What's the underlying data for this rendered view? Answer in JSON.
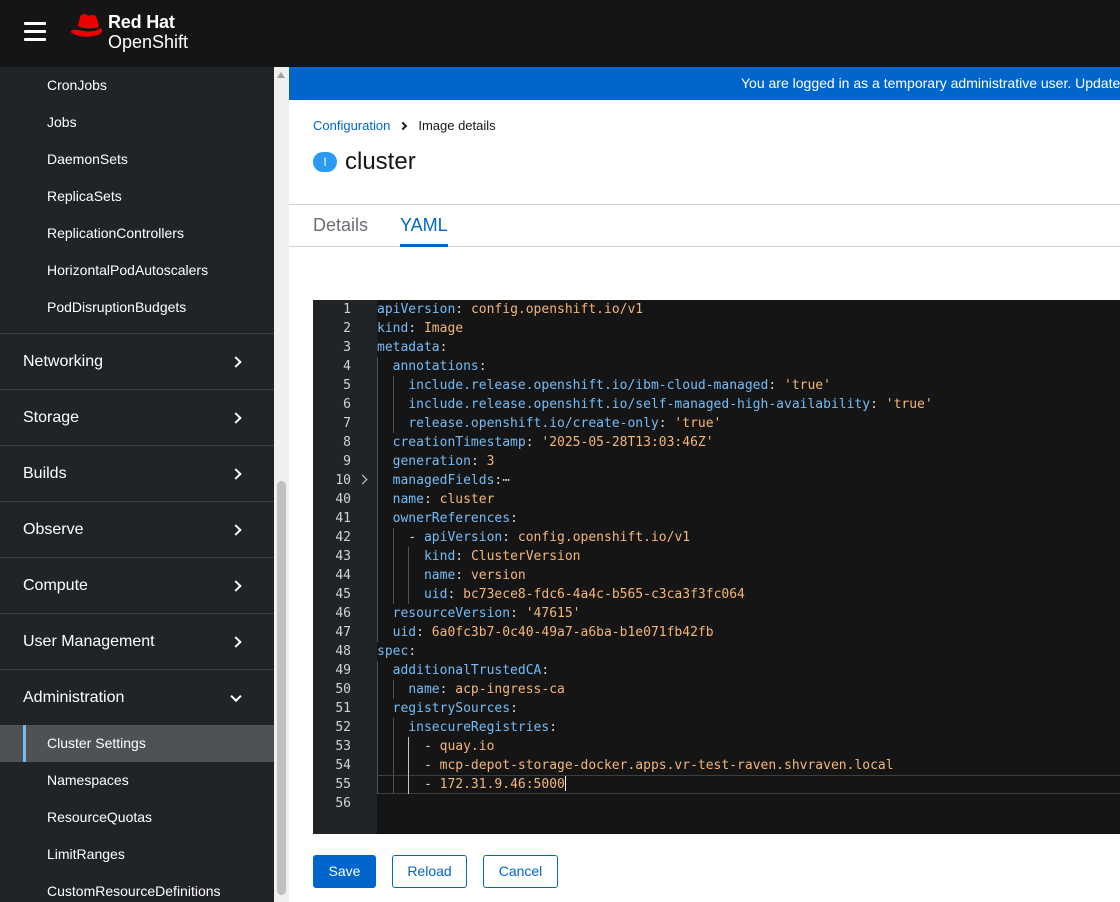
{
  "masthead": {
    "brand_line1": "Red Hat",
    "brand_line2": "OpenShift"
  },
  "sidebar": {
    "top_items": [
      "CronJobs",
      "Jobs",
      "DaemonSets",
      "ReplicaSets",
      "ReplicationControllers",
      "HorizontalPodAutoscalers",
      "PodDisruptionBudgets"
    ],
    "groups": [
      "Networking",
      "Storage",
      "Builds",
      "Observe",
      "Compute",
      "User Management",
      "Administration"
    ],
    "admin_items": [
      "Cluster Settings",
      "Namespaces",
      "ResourceQuotas",
      "LimitRanges",
      "CustomResourceDefinitions"
    ],
    "active_item": "Cluster Settings"
  },
  "banner": {
    "text": "You are logged in as a temporary administrative user. Update"
  },
  "breadcrumb": {
    "parent": "Configuration",
    "current": "Image details"
  },
  "page": {
    "badge": "I",
    "title": "cluster"
  },
  "tabs": {
    "details": "Details",
    "yaml": "YAML",
    "active": "YAML"
  },
  "editor": {
    "lines": [
      {
        "n": "1",
        "i": 0,
        "dash": false,
        "k": "apiVersion",
        "v": "config.openshift.io/v1"
      },
      {
        "n": "2",
        "i": 0,
        "dash": false,
        "k": "kind",
        "v": "Image"
      },
      {
        "n": "3",
        "i": 0,
        "dash": false,
        "k": "metadata",
        "v": ""
      },
      {
        "n": "4",
        "i": 1,
        "dash": false,
        "k": "annotations",
        "v": ""
      },
      {
        "n": "5",
        "i": 2,
        "dash": false,
        "k": "include.release.openshift.io/ibm-cloud-managed",
        "v": "'true'"
      },
      {
        "n": "6",
        "i": 2,
        "dash": false,
        "k": "include.release.openshift.io/self-managed-high-availability",
        "v": "'true'"
      },
      {
        "n": "7",
        "i": 2,
        "dash": false,
        "k": "release.openshift.io/create-only",
        "v": "'true'"
      },
      {
        "n": "8",
        "i": 1,
        "dash": false,
        "k": "creationTimestamp",
        "v": "'2025-05-28T13:03:46Z'"
      },
      {
        "n": "9",
        "i": 1,
        "dash": false,
        "k": "generation",
        "v": "3"
      },
      {
        "n": "10",
        "i": 1,
        "dash": false,
        "k": "managedFields",
        "v": "",
        "folded": true
      },
      {
        "n": "40",
        "i": 1,
        "dash": false,
        "k": "name",
        "v": "cluster"
      },
      {
        "n": "41",
        "i": 1,
        "dash": false,
        "k": "ownerReferences",
        "v": ""
      },
      {
        "n": "42",
        "i": 2,
        "dash": true,
        "k": "apiVersion",
        "v": "config.openshift.io/v1"
      },
      {
        "n": "43",
        "i": 3,
        "dash": false,
        "k": "kind",
        "v": "ClusterVersion"
      },
      {
        "n": "44",
        "i": 3,
        "dash": false,
        "k": "name",
        "v": "version"
      },
      {
        "n": "45",
        "i": 3,
        "dash": false,
        "k": "uid",
        "v": "bc73ece8-fdc6-4a4c-b565-c3ca3f3fc064"
      },
      {
        "n": "46",
        "i": 1,
        "dash": false,
        "k": "resourceVersion",
        "v": "'47615'"
      },
      {
        "n": "47",
        "i": 1,
        "dash": false,
        "k": "uid",
        "v": "6a0fc3b7-0c40-49a7-a6ba-b1e071fb42fb"
      },
      {
        "n": "48",
        "i": 0,
        "dash": false,
        "k": "spec",
        "v": ""
      },
      {
        "n": "49",
        "i": 1,
        "dash": false,
        "k": "additionalTrustedCA",
        "v": ""
      },
      {
        "n": "50",
        "i": 2,
        "dash": false,
        "k": "name",
        "v": "acp-ingress-ca"
      },
      {
        "n": "51",
        "i": 1,
        "dash": false,
        "k": "registrySources",
        "v": ""
      },
      {
        "n": "52",
        "i": 2,
        "dash": false,
        "k": "insecureRegistries",
        "v": ""
      },
      {
        "n": "53",
        "i": 3,
        "dash": true,
        "k": "",
        "v": "quay.io"
      },
      {
        "n": "54",
        "i": 3,
        "dash": true,
        "k": "",
        "v": "mcp-depot-storage-docker.apps.vr-test-raven.shvraven.local"
      },
      {
        "n": "55",
        "i": 3,
        "dash": true,
        "k": "",
        "v": "172.31.9.46:5000",
        "cursor": true
      },
      {
        "n": "56",
        "i": 0,
        "dash": false,
        "k": "",
        "v": ""
      }
    ]
  },
  "buttons": {
    "save": "Save",
    "reload": "Reload",
    "cancel": "Cancel"
  },
  "colors": {
    "accent": "#0066cc",
    "yaml_key": "#73bcf7",
    "yaml_value": "#f4b678"
  }
}
